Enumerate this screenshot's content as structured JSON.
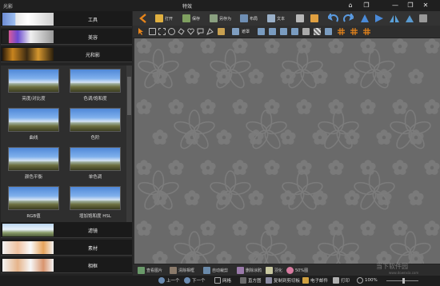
{
  "window": {
    "app_name": "光影",
    "title": "特效",
    "controls": [
      "⌂",
      "❐",
      "—",
      "❐",
      "✕"
    ]
  },
  "colors": {
    "background": "#2b2b2b",
    "canvas": "#6a6a6a",
    "accent_orange": "#e8851a"
  },
  "sidebar": {
    "categories_top": [
      {
        "label": "工具",
        "icon": "tools-thumbnail"
      },
      {
        "label": "美容",
        "icon": "beauty-thumbnail"
      },
      {
        "label": "光和影",
        "icon": "light-shadow-thumbnail"
      }
    ],
    "effects": [
      {
        "label": "亮度/对比度"
      },
      {
        "label": "色调/饱和度"
      },
      {
        "label": "曲线"
      },
      {
        "label": "色阶"
      },
      {
        "label": "颜色平衡"
      },
      {
        "label": "单色调"
      },
      {
        "label": "RGB值"
      },
      {
        "label": "增加饱和度 HSL"
      }
    ],
    "categories_bottom": [
      {
        "label": "滤镜",
        "icon": "filter-thumbnail"
      },
      {
        "label": "素材",
        "icon": "material-thumbnail"
      },
      {
        "label": "相框",
        "icon": "frame-thumbnail"
      }
    ]
  },
  "toolbar": {
    "back_icon": "back-arrow-icon",
    "open_label": "打开",
    "save_label": "保存",
    "save_as_label": "另存为",
    "layout_label": "布局",
    "text_label": "文本",
    "print_icon": "printer-icon",
    "email_icon": "email-icon"
  },
  "toolbar2": {
    "mode_label": "遮罩"
  },
  "bottombar": {
    "items": [
      {
        "label": "查看图片"
      },
      {
        "label": "清除相框"
      },
      {
        "label": "自动裁剪"
      },
      {
        "label": "删除涂鸦"
      },
      {
        "label": "羽化"
      },
      {
        "label": "50%图"
      }
    ]
  },
  "statusbar": {
    "prev_label": "上一个",
    "next_label": "下一个",
    "grid_label": "网格",
    "histogram_label": "直方图",
    "copy_label": "复制到剪切板",
    "email_label": "电子邮件",
    "print_label": "打印",
    "zoom": "100%"
  },
  "watermark": {
    "text": "当下软件园",
    "sub": "www.downxia.com"
  }
}
